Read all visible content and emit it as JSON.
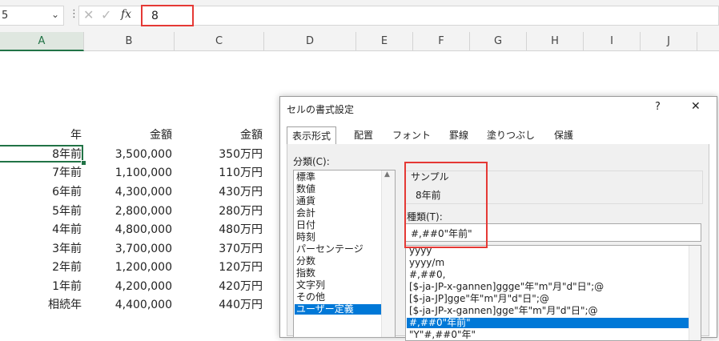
{
  "formula_bar": {
    "name_box": "5",
    "vertical_dots": "⋮",
    "cancel_icon": "✕",
    "enter_icon": "✓",
    "fx_label": "fx",
    "formula_value": "8"
  },
  "columns": [
    "A",
    "B",
    "C",
    "D",
    "E",
    "F",
    "G",
    "H",
    "I",
    "J"
  ],
  "table": {
    "headers": [
      "年",
      "金額",
      "金額"
    ],
    "rows": [
      [
        "8年前",
        "3,500,000",
        "350万円"
      ],
      [
        "7年前",
        "1,100,000",
        "110万円"
      ],
      [
        "6年前",
        "4,300,000",
        "430万円"
      ],
      [
        "5年前",
        "2,800,000",
        "280万円"
      ],
      [
        "4年前",
        "4,800,000",
        "480万円"
      ],
      [
        "3年前",
        "3,700,000",
        "370万円"
      ],
      [
        "2年前",
        "1,200,000",
        "120万円"
      ],
      [
        "1年前",
        "4,200,000",
        "420万円"
      ],
      [
        "相続年",
        "4,400,000",
        "440万円"
      ]
    ]
  },
  "dialog": {
    "title": "セルの書式設定",
    "help": "?",
    "close": "✕",
    "tabs": [
      "表示形式",
      "配置",
      "フォント",
      "罫線",
      "塗りつぶし",
      "保護"
    ],
    "category_label": "分類(C):",
    "categories": [
      "標準",
      "数値",
      "通貨",
      "会計",
      "日付",
      "時刻",
      "パーセンテージ",
      "分数",
      "指数",
      "文字列",
      "その他",
      "ユーザー定義"
    ],
    "selected_category": "ユーザー定義",
    "sample_label": "サンプル",
    "sample_value": "8年前",
    "type_label": "種類(T):",
    "type_value": "#,##0\"年前\"",
    "formats": [
      "yyyy",
      "yyyy/m",
      "#,##0,",
      "[$-ja-JP-x-gannen]ggge\"年\"m\"月\"d\"日\";@",
      "[$-ja-JP]gge\"年\"m\"月\"d\"日\";@",
      "[$-ja-JP-x-gannen]gge\"年\"m\"月\"d\"日\";@",
      "#,##0\"年前\"",
      "\"Y\"#,##0\"年\""
    ],
    "selected_format": "#,##0\"年前\""
  },
  "colors": {
    "excel_green": "#217346",
    "highlight_red": "#e53935",
    "selection_blue": "#0078d7"
  }
}
